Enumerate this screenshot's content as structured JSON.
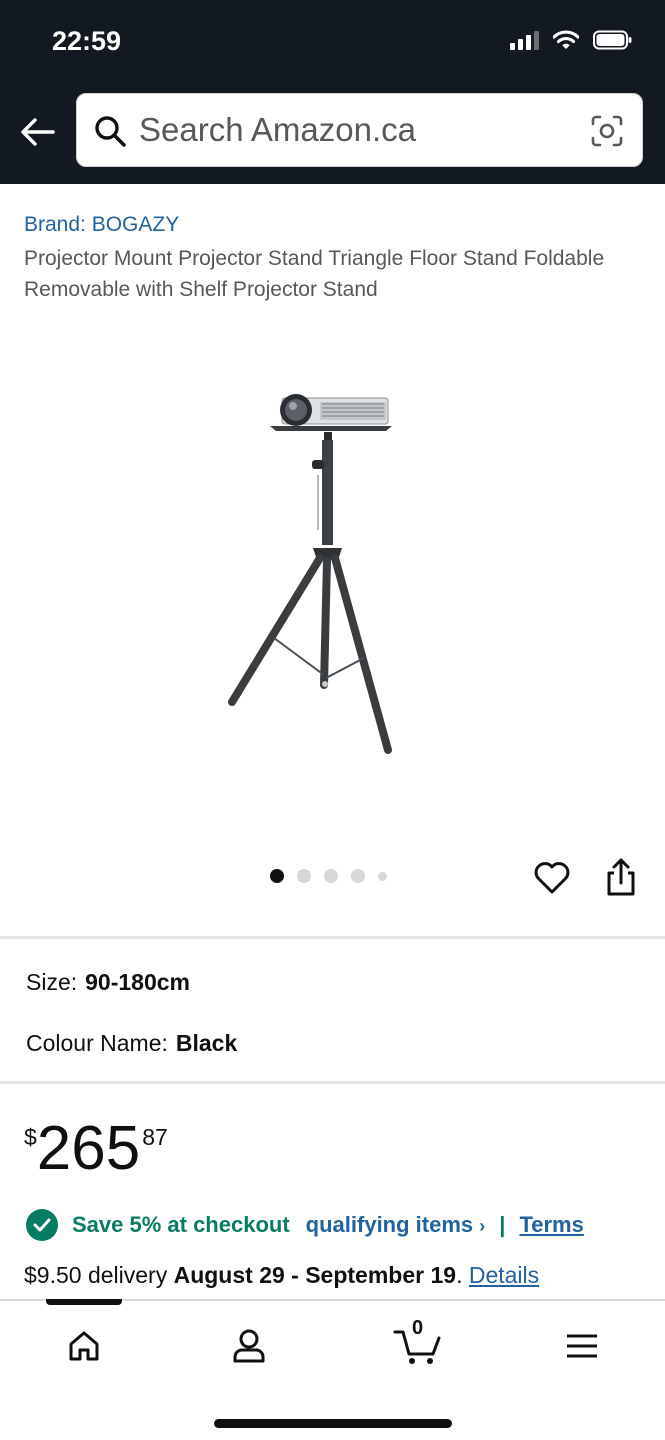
{
  "status_bar": {
    "time": "22:59"
  },
  "search": {
    "placeholder": "Search Amazon.ca"
  },
  "product": {
    "brand": "Brand: BOGAZY",
    "title": "Projector Mount Projector Stand Triangle Floor Stand Foldable Removable with Shelf Projector Stand",
    "image_count": 5,
    "active_image": 1
  },
  "specs": {
    "size_label": "Size:",
    "size_value": "90-180cm",
    "colour_label": "Colour Name:",
    "colour_value": "Black"
  },
  "price": {
    "currency": "$",
    "whole": "265",
    "fraction": "87"
  },
  "promo": {
    "save_text": "Save 5% at checkout",
    "qualifying_text": "qualifying items",
    "chevron": "›",
    "separator": "|",
    "terms_text": "Terms"
  },
  "delivery": {
    "prefix": "$9.50 delivery ",
    "dates": "August 29 - September 19",
    "suffix": ". ",
    "details_link": "Details"
  },
  "bottom_nav": {
    "cart_count": "0"
  },
  "colors": {
    "header_bg": "#131921",
    "link_blue": "#2162a1",
    "promo_green": "#067d62",
    "text_dark": "#0f1111",
    "text_muted": "#565959"
  }
}
